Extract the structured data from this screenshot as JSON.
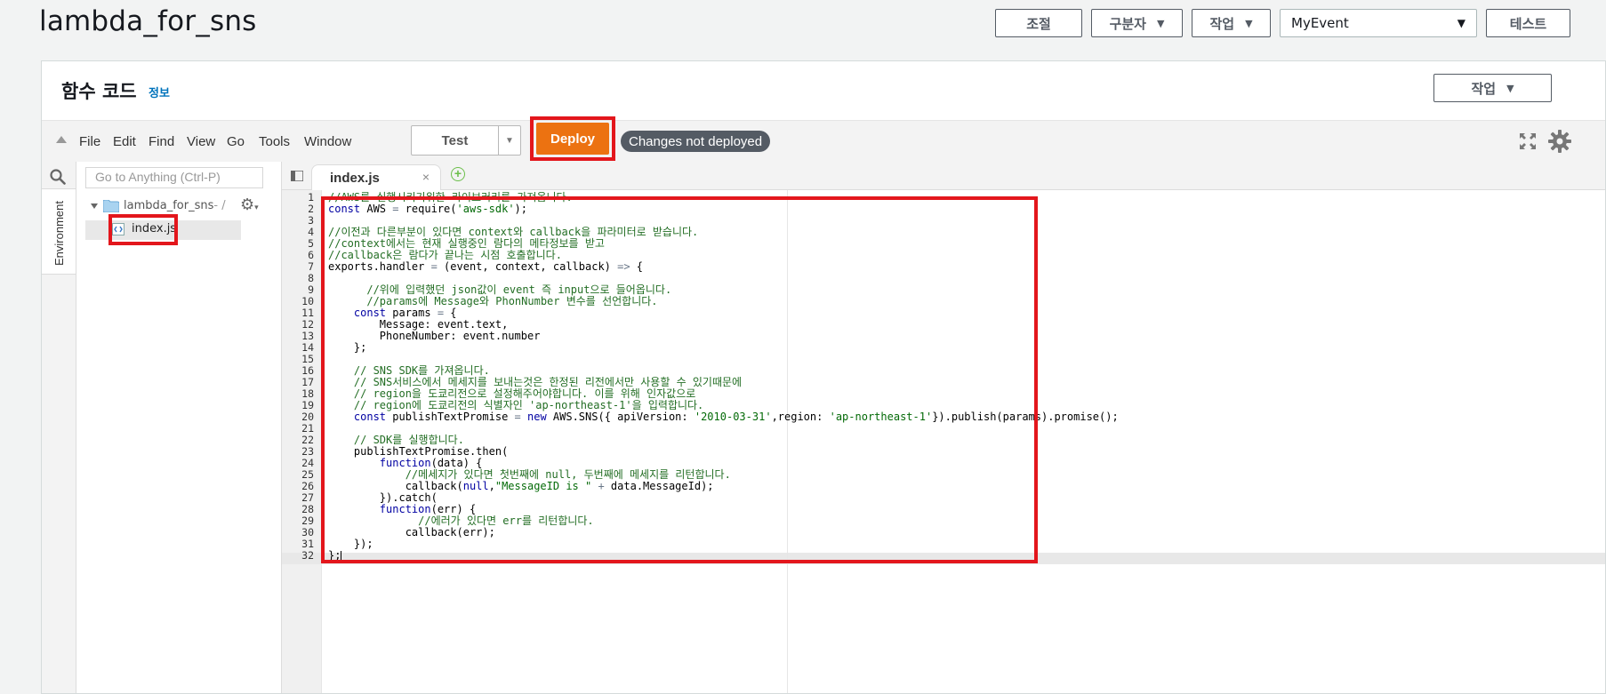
{
  "page": {
    "title": "lambda_for_sns"
  },
  "top_actions": {
    "throttle": "조절",
    "qualifiers": "구분자",
    "actions": "작업",
    "test_event": "MyEvent",
    "test": "테스트"
  },
  "panel": {
    "title": "함수 코드",
    "info": "정보",
    "action": "작업"
  },
  "menubar": {
    "items": [
      "File",
      "Edit",
      "Find",
      "View",
      "Go",
      "Tools",
      "Window"
    ],
    "test_label": "Test",
    "deploy_label": "Deploy",
    "status_badge": "Changes not deployed"
  },
  "leftbar": {
    "environment_label": "Environment"
  },
  "tree": {
    "goto_placeholder": "Go to Anything (Ctrl-P)",
    "folder": "lambda_for_sns",
    "folder_suffix": " - /",
    "file": "index.js"
  },
  "editor": {
    "tab_name": "index.js",
    "close": "×",
    "add": "+",
    "lines": [
      "//AWS를 실행시키기위한 라이브러리를 가져옵니다.",
      "const AWS = require('aws-sdk');",
      "",
      "//이전과 다른부분이 있다면 context와 callback을 파라미터로 받습니다.",
      "//context에서는 현재 실행중인 람다의 메타정보를 받고",
      "//callback은 람다가 끝나는 시점 호출합니다.",
      "exports.handler = (event, context, callback) => {",
      "",
      "      //위에 입력했던 json값이 event 즉 input으로 들어옵니다.",
      "      //params에 Message와 PhonNumber 변수를 선언합니다.",
      "    const params = {",
      "        Message: event.text,",
      "        PhoneNumber: event.number",
      "    };",
      "",
      "    // SNS SDK를 가져옵니다.",
      "    // SNS서비스에서 메세지를 보내는것은 한정된 리전에서만 사용할 수 있기때문에",
      "    // region을 도쿄리전으로 설정해주어야합니다. 이를 위해 인자값으로",
      "    // region에 도쿄리전의 식별자인 'ap-northeast-1'을 입력합니다.",
      "    const publishTextPromise = new AWS.SNS({ apiVersion: '2010-03-31',region: 'ap-northeast-1'}).publish(params).promise();",
      "",
      "    // SDK를 실행합니다.",
      "    publishTextPromise.then(",
      "        function(data) {",
      "            //메세지가 있다면 첫번째에 null, 두번째에 메세지를 리턴합니다.",
      "            callback(null,\"MessageID is \" + data.MessageId);",
      "        }).catch(",
      "        function(err) {",
      "              //에러가 있다면 err를 리턴합니다.",
      "            callback(err);",
      "    });",
      "};"
    ]
  }
}
